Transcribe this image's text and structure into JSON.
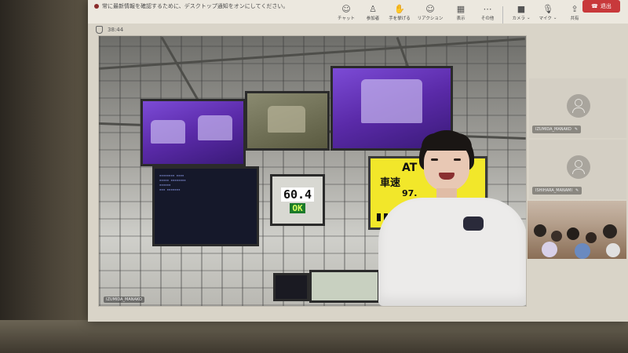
{
  "notification": {
    "text": "常に最新情報を確認するために、デスクトップ通知をオンにしてください。"
  },
  "meeting": {
    "elapsed": "38:44"
  },
  "toolbar": {
    "chat": "チャット",
    "people": "参加者",
    "raise_hand": "手を挙げる",
    "reactions": "リアクション",
    "view": "表示",
    "more": "その他",
    "camera": "カメラ",
    "mic": "マイク",
    "share": "共有",
    "leave": "退出",
    "icons": {
      "chat": "chat-icon",
      "people": "people-icon",
      "raise_hand": "hand-icon",
      "reactions": "smiley-icon",
      "view": "grid-icon",
      "more": "ellipsis-icon",
      "camera": "camera-icon",
      "mic": "mic-icon",
      "share": "share-icon",
      "leave": "phone-icon"
    },
    "leave_color": "#c8393b"
  },
  "main_video": {
    "gauge_value": "60.4",
    "gauge_status": "OK",
    "sign_line1": "AT",
    "sign_line2": "車速",
    "sign_line3": "97.",
    "participant_label": "IZUMIDA_MANAKO"
  },
  "participants": [
    {
      "name": "IZUMIDA_MANAKO"
    },
    {
      "name": "ISHIHARA_MANAMI"
    }
  ]
}
